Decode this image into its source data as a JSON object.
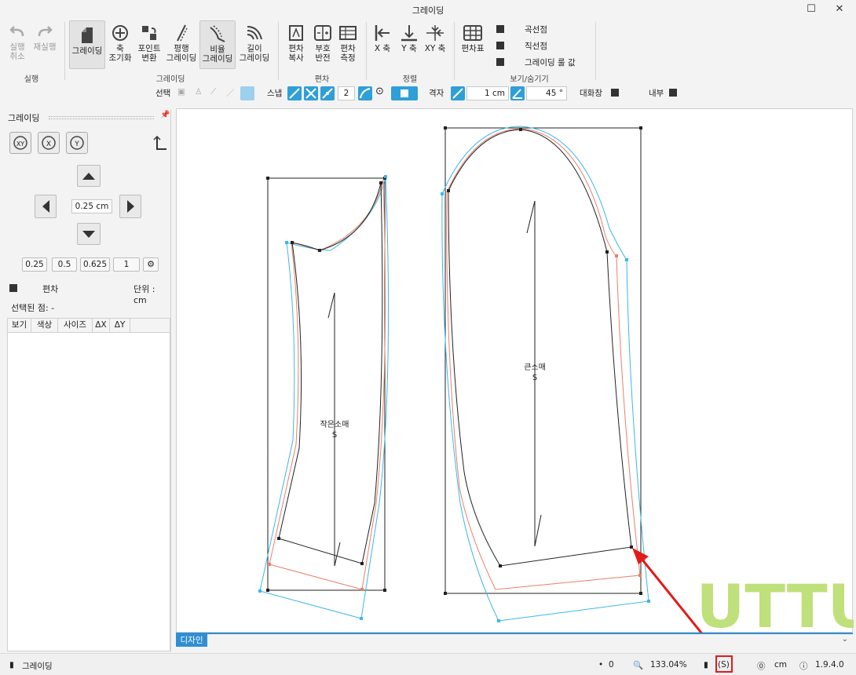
{
  "window": {
    "title": "그레이딩"
  },
  "ribbon": {
    "groups": [
      {
        "label": "실행",
        "buttons": [
          "실행\n취소",
          "재실행"
        ]
      },
      {
        "label": "그레이딩",
        "buttons": [
          "그레이딩",
          "축\n조기화",
          "포인트\n변환",
          "평행\n그레이딩",
          "비율\n그레이딩",
          "길이\n그레이딩"
        ]
      },
      {
        "label": "편차",
        "buttons": [
          "편차\n복사",
          "부호\n반전",
          "편차\n측정"
        ]
      },
      {
        "label": "정렬",
        "buttons": [
          "X 축",
          "Y 축",
          "XY 축"
        ]
      },
      {
        "label": "보기/숨기기",
        "buttons": [
          "편차표"
        ]
      }
    ],
    "undo_l1": "실행",
    "undo_l2": "취소",
    "redo": "재실행",
    "grading": "그레이딩",
    "axis_l1": "축",
    "axis_l2": "조기화",
    "point_l1": "포인트",
    "point_l2": "변환",
    "parallel_l1": "평행",
    "parallel_l2": "그레이딩",
    "ratio_l1": "비율",
    "ratio_l2": "그레이딩",
    "length_l1": "길이",
    "length_l2": "그레이딩",
    "devcopy_l1": "편차",
    "devcopy_l2": "복사",
    "signflip_l1": "부호",
    "signflip_l2": "반전",
    "devmeasure_l1": "편차",
    "devmeasure_l2": "측정",
    "x_axis": "X 축",
    "y_axis": "Y 축",
    "xy_axis": "XY 축",
    "dev_table": "편차표",
    "show_curve": "곡선점",
    "show_straight": "직선점",
    "show_grade_value": "그레이딩 룰 값",
    "grp_exec": "실행",
    "grp_grading": "그레이딩",
    "grp_dev": "편차",
    "grp_align": "정렬",
    "grp_view": "보기/숨기기"
  },
  "toolrow": {
    "select": "선택",
    "snap": "스냅",
    "snap_count": "2",
    "grid": "격자",
    "grid_size": "1 cm",
    "angle": "45 °",
    "dialog": "대화창",
    "inside": "내부"
  },
  "panel": {
    "title": "그레이딩",
    "step_value": "0.25 cm",
    "presets": [
      "0.25",
      "0.5",
      "0.625",
      "1"
    ],
    "deviation": "편차",
    "unit": "단위 : cm",
    "selected_point": "선택된 점: -",
    "columns": [
      "보기",
      "색상",
      "사이즈",
      "ΔX",
      "ΔY"
    ]
  },
  "canvas": {
    "piece_small": "작은소매",
    "piece_large": "큰소매",
    "s_marker": "S",
    "watermark": "UTTU"
  },
  "doc_tab": "디자인",
  "status": {
    "mode": "그레이딩",
    "count": "0",
    "zoom": "133.04%",
    "size": "(S)",
    "unit": "cm",
    "version": "1.9.4.0"
  },
  "colors": {
    "accent": "#2f8fd4",
    "cyan": "#3cb7e8",
    "salmon": "#e8806a",
    "highlight": "#e21b1b",
    "watermark": "#bfe07a"
  }
}
